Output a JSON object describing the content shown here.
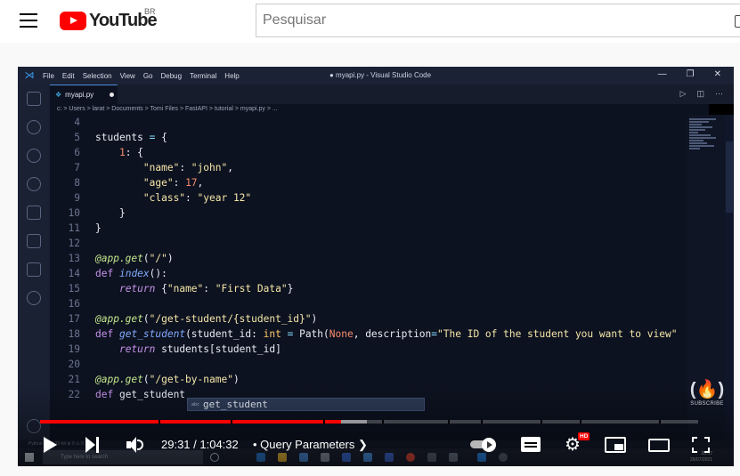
{
  "header": {
    "logo_text": "YouTube",
    "country_code": "BR",
    "search_placeholder": "Pesquisar"
  },
  "vscode": {
    "menu": [
      "File",
      "Edit",
      "Selection",
      "View",
      "Go",
      "Debug",
      "Terminal",
      "Help"
    ],
    "window_title": "● myapi.py - Visual Studio Code",
    "tab_label": "myapi.py",
    "breadcrumb": "c: > Users > larat > Documents > Tomi Files > FastAPI > tutorial > myapi.py > ...",
    "line_numbers": [
      "4",
      "5",
      "6",
      "7",
      "8",
      "9",
      "10",
      "11",
      "12",
      "13",
      "14",
      "15",
      "16",
      "17",
      "18",
      "19",
      "20",
      "21",
      "22"
    ],
    "suggestion": "get_student",
    "status_left": "Python 3.8.2 32-bit  ⊗ 0 ⚠ 0",
    "taskbar_search": "Type here to search",
    "clock": [
      "20:37",
      "26/07/2021"
    ]
  },
  "watermark": {
    "sub_label": "SUBSCRIBE"
  },
  "player": {
    "current_time": "29:31",
    "duration": "1:04:32",
    "time_text": "29:31 / 1:04:32",
    "chapter_title": "Query Parameters",
    "quality_badge": "HD",
    "progress_fraction": 0.457,
    "buffered_end_fraction": 0.497,
    "chapter_breaks": [
      0.18,
      0.29,
      0.43,
      0.52,
      0.62,
      0.67,
      0.76,
      0.82,
      0.94
    ]
  },
  "colors": {
    "accent_red": "#ff0000",
    "editor_bg": "#0d1220"
  }
}
